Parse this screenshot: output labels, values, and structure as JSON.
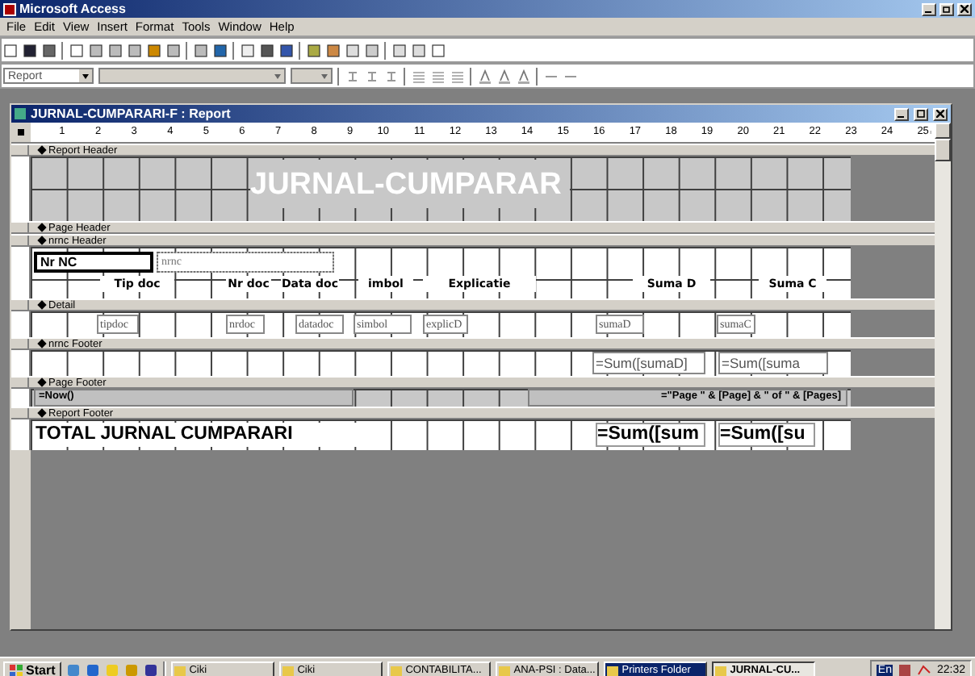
{
  "app_title": "Microsoft Access",
  "menu": [
    "File",
    "Edit",
    "View",
    "Insert",
    "Format",
    "Tools",
    "Window",
    "Help"
  ],
  "format_toolbar": {
    "object_combo": "Report"
  },
  "report_window": {
    "title": "JURNAL-CUMPARARI-F : Report",
    "ruler": [
      "1",
      "2",
      "3",
      "4",
      "5",
      "6",
      "7",
      "8",
      "9",
      "10",
      "11",
      "12",
      "13",
      "14",
      "15",
      "16",
      "17",
      "18",
      "19",
      "20",
      "21",
      "22",
      "23",
      "24",
      "25"
    ],
    "sections": [
      {
        "label": "Report Header",
        "kind": "title",
        "controls": [
          {
            "text": "JURNAL-CUMPARAR",
            "kind": "label"
          }
        ]
      },
      {
        "label": "Page Header",
        "kind": "empty"
      },
      {
        "label": "nrnc Header",
        "kind": "group",
        "controls": [
          {
            "text": "Nr NC",
            "kind": "label"
          },
          {
            "text": "nrnc",
            "kind": "textbox"
          },
          {
            "text": "Tip doc",
            "kind": "label"
          },
          {
            "text": "Nr doc",
            "kind": "label"
          },
          {
            "text": "Data doc",
            "kind": "label"
          },
          {
            "text": "imbol",
            "kind": "label"
          },
          {
            "text": "Explicatie",
            "kind": "label"
          },
          {
            "text": "Suma D",
            "kind": "label"
          },
          {
            "text": "Suma C",
            "kind": "label"
          }
        ]
      },
      {
        "label": "Detail",
        "kind": "detail",
        "controls": [
          {
            "text": "tipdoc",
            "kind": "textbox"
          },
          {
            "text": "nrdoc",
            "kind": "textbox"
          },
          {
            "text": "datadoc",
            "kind": "textbox"
          },
          {
            "text": "simbol",
            "kind": "textbox"
          },
          {
            "text": "explicD",
            "kind": "textbox"
          },
          {
            "text": "sumaD",
            "kind": "textbox"
          },
          {
            "text": "sumaC",
            "kind": "textbox"
          }
        ]
      },
      {
        "label": "nrnc Footer",
        "kind": "footer",
        "controls": [
          {
            "text": "=Sum([sumaD]",
            "kind": "textbox"
          },
          {
            "text": "=Sum([suma",
            "kind": "textbox"
          }
        ]
      },
      {
        "label": "Page Footer",
        "kind": "page",
        "controls": [
          {
            "text": "=Now()",
            "kind": "textbox"
          },
          {
            "text": "=\"Page \" & [Page] & \" of \" & [Pages]",
            "kind": "textbox"
          }
        ]
      },
      {
        "label": "Report Footer",
        "kind": "total",
        "controls": [
          {
            "text": "TOTAL JURNAL CUMPARARI",
            "kind": "label"
          },
          {
            "text": "=Sum([sum",
            "kind": "textbox"
          },
          {
            "text": "=Sum([su",
            "kind": "textbox"
          }
        ]
      }
    ]
  },
  "taskbar": {
    "start": "Start",
    "tasks": [
      {
        "label": "Ciki",
        "selected": false,
        "flashing": false
      },
      {
        "label": "Ciki",
        "selected": false,
        "flashing": false
      },
      {
        "label": "CONTABILITA...",
        "selected": false,
        "flashing": false
      },
      {
        "label": "ANA-PSI : Data...",
        "selected": false,
        "flashing": false
      },
      {
        "label": "Printers Folder",
        "selected": false,
        "flashing": true
      },
      {
        "label": "JURNAL-CU...",
        "selected": true,
        "flashing": false
      }
    ],
    "language": "En",
    "clock": "22:32"
  }
}
